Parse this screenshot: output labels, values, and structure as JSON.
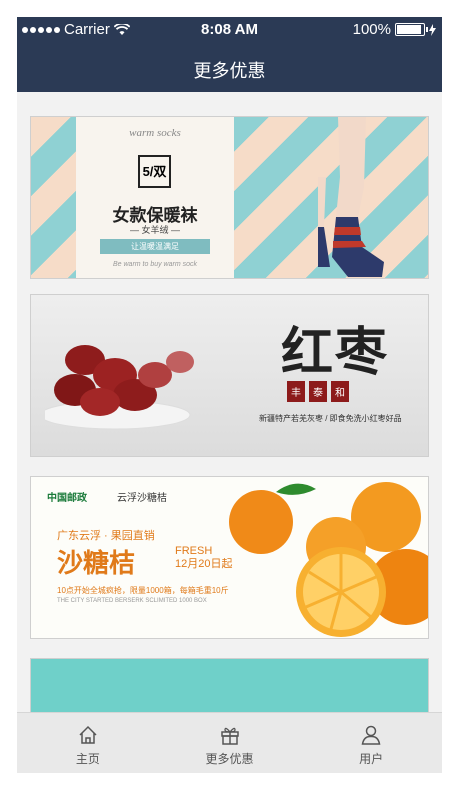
{
  "status_bar": {
    "carrier": "Carrier",
    "time": "8:08 AM",
    "battery": "100%"
  },
  "nav": {
    "title": "更多优惠"
  },
  "banners": [
    {
      "script_text": "warm socks",
      "logo_text": "5/双",
      "headline": "女款保暖袜",
      "subline": "— 女羊绒 —",
      "tag": "让温暖温满足",
      "footer": "Be warm to buy warm sock"
    },
    {
      "headline": "红枣",
      "seal": [
        "丰",
        "泰",
        "和"
      ],
      "subline": "新疆特产若羌灰枣 / 即食免洗小红枣好品"
    },
    {
      "brand": "中国邮政",
      "brand2": "云浮沙糖桔",
      "line1": "广东云浮 · 果园直销",
      "headline": "沙糖桔",
      "fresh": "FRESH",
      "date": "12月20日起",
      "line2": "10点开始全城疯抢，限量1000箱，每箱毛重10斤",
      "line3": "THE CITY STARTED BERSERK SCLIMITED 1000 BOX"
    }
  ],
  "tabs": [
    {
      "label": "主页",
      "icon": "home-icon"
    },
    {
      "label": "更多优惠",
      "icon": "gift-icon"
    },
    {
      "label": "用户",
      "icon": "user-icon"
    }
  ],
  "colors": {
    "nav_bg": "#2b3a55",
    "tab_bg": "#e9e9e9"
  }
}
